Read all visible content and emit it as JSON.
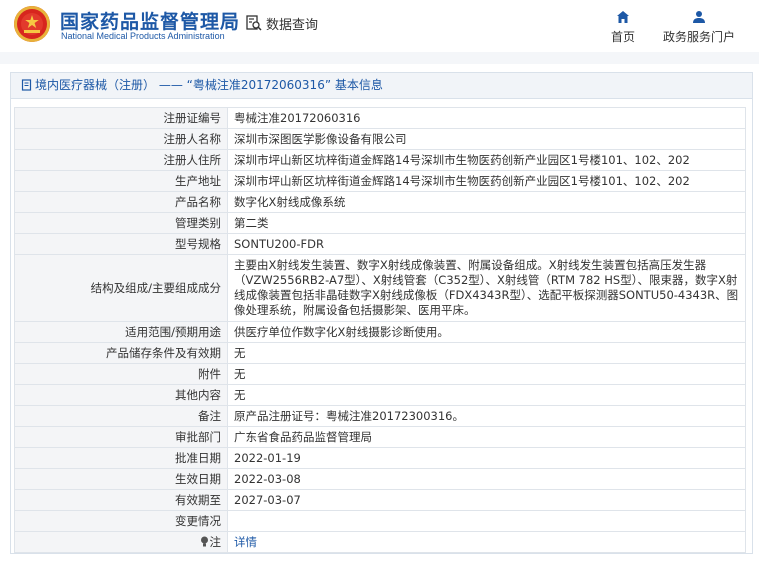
{
  "header": {
    "brand_cn": "国家药品监督管理局",
    "brand_en": "National Medical Products Administration",
    "query_label": "数据查询",
    "nav": [
      {
        "label": "首页",
        "icon": "home-icon"
      },
      {
        "label": "政务服务门户",
        "icon": "user-icon"
      }
    ]
  },
  "panel": {
    "title": "境内医疗器械（注册） —— “粤械注准20172060316” 基本信息"
  },
  "rows": [
    {
      "label": "注册证编号",
      "value": "粤械注准20172060316"
    },
    {
      "label": "注册人名称",
      "value": "深圳市深图医学影像设备有限公司"
    },
    {
      "label": "注册人住所",
      "value": "深圳市坪山新区坑梓街道金辉路14号深圳市生物医药创新产业园区1号楼101、102、202"
    },
    {
      "label": "生产地址",
      "value": "深圳市坪山新区坑梓街道金辉路14号深圳市生物医药创新产业园区1号楼101、102、202"
    },
    {
      "label": "产品名称",
      "value": "数字化X射线成像系统"
    },
    {
      "label": "管理类别",
      "value": "第二类"
    },
    {
      "label": "型号规格",
      "value": "SONTU200-FDR"
    },
    {
      "label": "结构及组成/主要组成成分",
      "value": "主要由X射线发生装置、数字X射线成像装置、附属设备组成。X射线发生装置包括高压发生器（VZW2556RB2-A7型）、X射线管套（C352型）、X射线管（RTM 782 HS型）、限束器，数字X射线成像装置包括非晶硅数字X射线成像板（FDX4343R型）、选配平板探测器SONTU50-4343R、图像处理系统，附属设备包括摄影架、医用平床。"
    },
    {
      "label": "适用范围/预期用途",
      "value": "供医疗单位作数字化X射线摄影诊断使用。"
    },
    {
      "label": "产品储存条件及有效期",
      "value": "无"
    },
    {
      "label": "附件",
      "value": "无"
    },
    {
      "label": "其他内容",
      "value": "无"
    },
    {
      "label": "备注",
      "value": "原产品注册证号：粤械注准20172300316。"
    },
    {
      "label": "审批部门",
      "value": "广东省食品药品监督管理局"
    },
    {
      "label": "批准日期",
      "value": "2022-01-19"
    },
    {
      "label": "生效日期",
      "value": "2022-03-08"
    },
    {
      "label": "有效期至",
      "value": "2027-03-07"
    },
    {
      "label": "变更情况",
      "value": ""
    },
    {
      "label": "注",
      "value": "详情"
    }
  ],
  "colors": {
    "brand_blue": "#1d58a6",
    "logo_red": "#d7261e"
  }
}
